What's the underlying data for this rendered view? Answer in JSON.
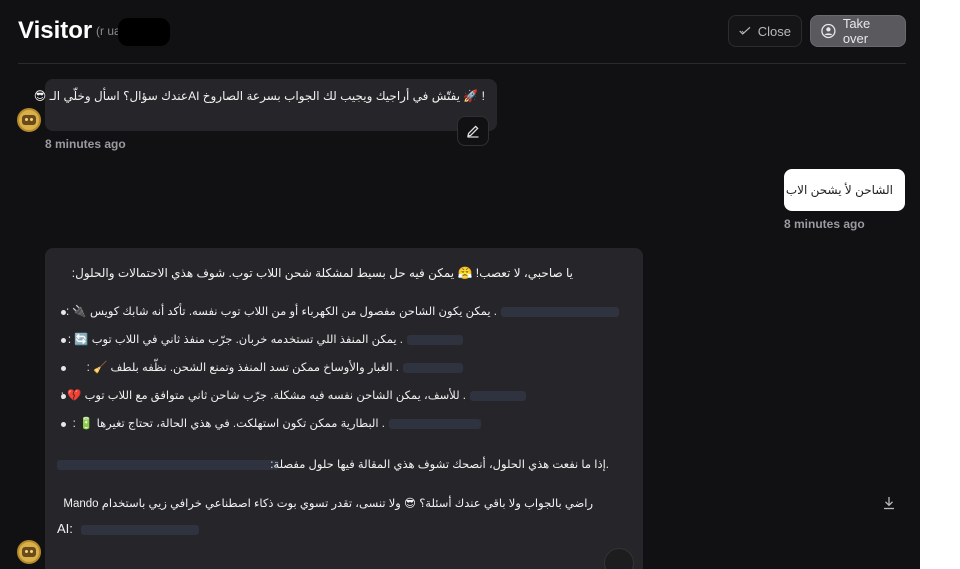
{
  "header": {
    "title": "Visitor",
    "subtitle": "(r         ua)",
    "close_label": "Close",
    "take_over_label": "Take over"
  },
  "messages": {
    "first_bot": {
      "text": "! 🚀 يفتّش في أراجيك ويجيب لك الجواب بسرعة الصاروخ AIعندك سؤال؟ اسأل وخلّي الـ 😎",
      "time": "8 minutes ago"
    },
    "user": {
      "text": "الشاحن لأ يشحن الاب",
      "time": "8 minutes ago"
    },
    "second_bot": {
      "intro": "يا صاحبي، لا تعصب! 😤 يمكن فيه حل بسيط لمشكلة شحن اللاب توب. شوف هذي الاحتمالات والحلول:",
      "items": [
        ". يمكن يكون الشاحن مفصول من الكهرباء أو من اللاب توب نفسه. تأكد أنه شابك كويس 🔌 :",
        ". يمكن المنفذ اللي تستخدمه خربان. جرّب منفذ ثاني في اللاب توب 🔄 :",
        ". الغبار والأوساخ ممكن تسد المنفذ وتمنع الشحن. نظّفه بلطف 🧹 :",
        ". للأسف، يمكن الشاحن نفسه فيه مشكلة. جرّب شاحن ثاني متوافق مع اللاب توب 💔 :",
        ". البطارية ممكن تكون استهلكت. في هذي الحالة، تحتاج تغيرها 🔋 :"
      ],
      "article_line": ".إذا ما نفعت هذي الحلول، أنصحك تشوف هذي المقالة فيها حلول مفصلة:",
      "closing_line": "راضي بالجواب ولا باقي عندك أسئلة؟ 😎 ولا تنسى، تقدر تسوي بوت ذكاء اصطناعي خرافي زيي باستخدام Mando",
      "closing_tail": "AI:"
    }
  },
  "icons": {
    "close": "check-icon",
    "take_over": "user-circle-icon",
    "edit": "pencil-icon",
    "download": "download-icon",
    "avatar": "bot-avatar-icon"
  },
  "colors": {
    "background": "#111113",
    "bot_bubble": "#26262a",
    "user_bubble": "#ffffff",
    "take_over_button": "#5a5a5e"
  }
}
